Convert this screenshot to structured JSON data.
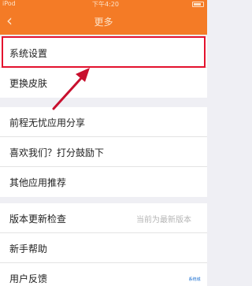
{
  "status_bar": {
    "carrier": "iPod",
    "time": "下午4:20"
  },
  "nav": {
    "title": "更多"
  },
  "group1": [
    {
      "label": "系统设置"
    },
    {
      "label": "更换皮肤"
    }
  ],
  "group2": [
    {
      "label": "前程无忧应用分享"
    },
    {
      "label": "喜欢我们？打分鼓励下"
    },
    {
      "label": "其他应用推荐"
    }
  ],
  "group3": [
    {
      "label": "版本更新检查",
      "value": "当前为最新版本"
    },
    {
      "label": "新手帮助"
    },
    {
      "label": "用户反馈"
    }
  ],
  "colors": {
    "accent": "#f47b26",
    "highlight": "#e3122e"
  },
  "icons": {
    "back": "chevron-left-icon"
  },
  "watermark": "系统城"
}
